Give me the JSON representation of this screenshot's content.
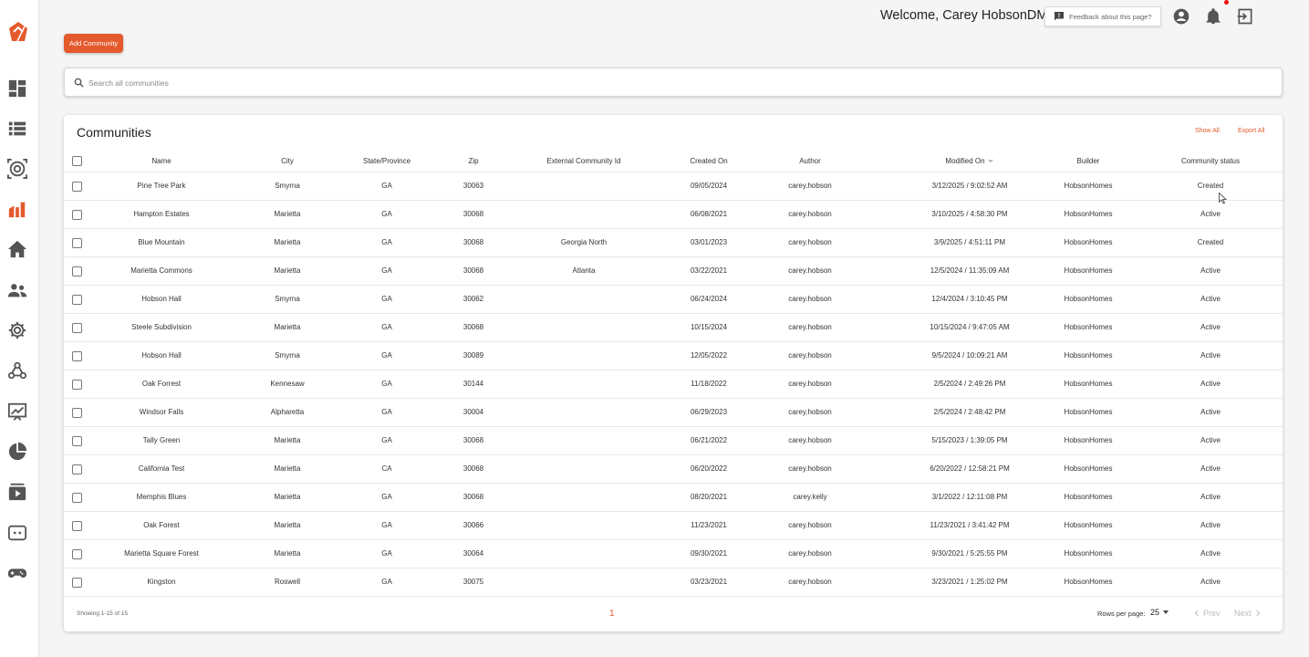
{
  "header": {
    "welcome": "Welcome, Carey HobsonDM",
    "feedback_label": "Feedback about this page?"
  },
  "actions": {
    "add_community": "Add Community"
  },
  "search": {
    "placeholder": "Search all communities"
  },
  "communities": {
    "title": "Communities",
    "show_all": "Show All",
    "export_all": "Export All",
    "columns": [
      "Name",
      "City",
      "State/Province",
      "Zip",
      "External Community Id",
      "Created On",
      "Author",
      "Modified On",
      "Builder",
      "Community status"
    ],
    "rows": [
      [
        "Pine Tree Park",
        "Smyrna",
        "GA",
        "30063",
        "",
        "09/05/2024",
        "carey.hobson",
        "3/12/2025 / 9:02:52 AM",
        "HobsonHomes",
        "Created"
      ],
      [
        "Hampton Estates",
        "Marietta",
        "GA",
        "30068",
        "",
        "06/08/2021",
        "carey.hobson",
        "3/10/2025 / 4:58:30 PM",
        "HobsonHomes",
        "Active"
      ],
      [
        "Blue Mountain",
        "Marietta",
        "GA",
        "30068",
        "Georgia North",
        "03/01/2023",
        "carey.hobson",
        "3/9/2025 / 4:51:11 PM",
        "HobsonHomes",
        "Created"
      ],
      [
        "Marietta Commons",
        "Marietta",
        "GA",
        "30068",
        "Atlanta",
        "03/22/2021",
        "carey.hobson",
        "12/5/2024 / 11:35:09 AM",
        "HobsonHomes",
        "Active"
      ],
      [
        "Hobson Hall",
        "Smyrna",
        "GA",
        "30062",
        "",
        "06/24/2024",
        "carey.hobson",
        "12/4/2024 / 3:10:45 PM",
        "HobsonHomes",
        "Active"
      ],
      [
        "Steele Subdivision",
        "Marietta",
        "GA",
        "30068",
        "",
        "10/15/2024",
        "carey.hobson",
        "10/15/2024 / 9:47:05 AM",
        "HobsonHomes",
        "Active"
      ],
      [
        "Hobson Hall",
        "Smyrna",
        "GA",
        "30089",
        "",
        "12/05/2022",
        "carey.hobson",
        "9/5/2024 / 10:09:21 AM",
        "HobsonHomes",
        "Active"
      ],
      [
        "Oak Forrest",
        "Kennesaw",
        "GA",
        "30144",
        "",
        "11/18/2022",
        "carey.hobson",
        "2/5/2024 / 2:49:26 PM",
        "HobsonHomes",
        "Active"
      ],
      [
        "Windsor Falls",
        "Alpharetta",
        "GA",
        "30004",
        "",
        "06/29/2023",
        "carey.hobson",
        "2/5/2024 / 2:48:42 PM",
        "HobsonHomes",
        "Active"
      ],
      [
        "Tally Green",
        "Marietta",
        "GA",
        "30068",
        "",
        "06/21/2022",
        "carey.hobson",
        "5/15/2023 / 1:39:05 PM",
        "HobsonHomes",
        "Active"
      ],
      [
        "California Test",
        "Marietta",
        "CA",
        "30068",
        "",
        "06/20/2022",
        "carey.hobson",
        "6/20/2022 / 12:58:21 PM",
        "HobsonHomes",
        "Active"
      ],
      [
        "Memphis Blues",
        "Marietta",
        "GA",
        "30068",
        "",
        "08/20/2021",
        "carey.kelly",
        "3/1/2022 / 12:11:08 PM",
        "HobsonHomes",
        "Active"
      ],
      [
        "Oak Forest",
        "Marietta",
        "GA",
        "30066",
        "",
        "11/23/2021",
        "carey.hobson",
        "11/23/2021 / 3:41:42 PM",
        "HobsonHomes",
        "Active"
      ],
      [
        "Marietta Square Forest",
        "Marietta",
        "GA",
        "30064",
        "",
        "09/30/2021",
        "carey.hobson",
        "9/30/2021 / 5:25:55 PM",
        "HobsonHomes",
        "Active"
      ],
      [
        "Kingston",
        "Roswell",
        "GA",
        "30075",
        "",
        "03/23/2021",
        "carey.hobson",
        "3/23/2021 / 1:25:02 PM",
        "HobsonHomes",
        "Active"
      ]
    ]
  },
  "pagination": {
    "showing": "Showing 1-15 of 15",
    "current_page": "1",
    "rows_per_page_label": "Rows per page:",
    "rows_per_page_value": "25",
    "prev": "Prev",
    "next": "Next"
  },
  "theme": {
    "accent": "#e45a2c"
  },
  "icons": {
    "sidebar": [
      "dashboard-icon",
      "list-icon",
      "target-icon",
      "building-chart-icon",
      "home-icon",
      "people-icon",
      "gear-icon",
      "webhook-icon",
      "presentation-chart-icon",
      "pie-chart-icon",
      "video-library-icon",
      "chat-bot-icon",
      "gamepad-icon"
    ],
    "header": [
      "feedback-icon",
      "account-circle-icon",
      "bell-icon",
      "logout-icon"
    ]
  }
}
